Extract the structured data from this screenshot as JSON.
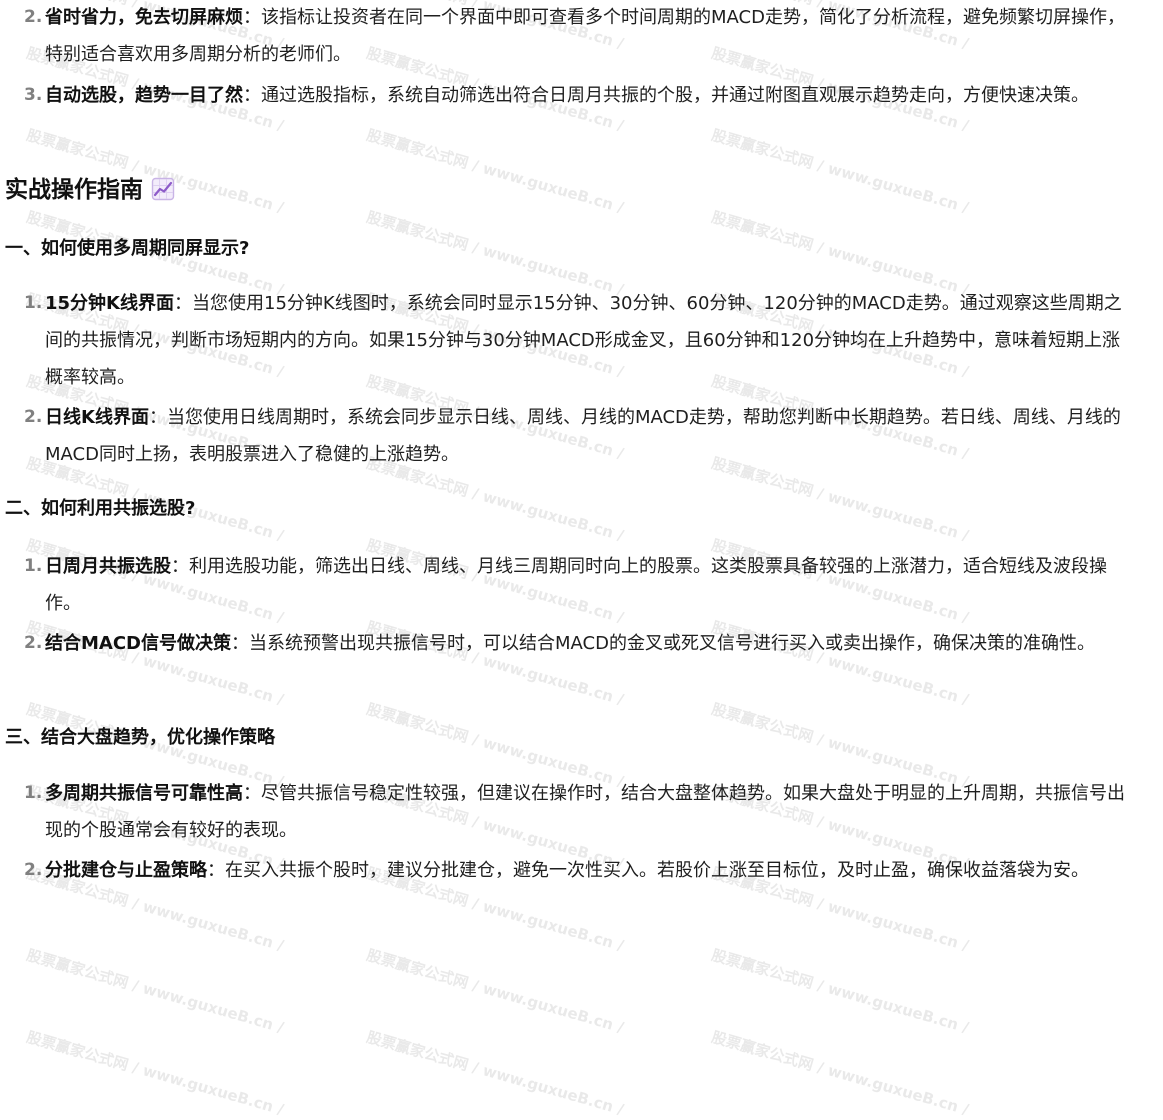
{
  "watermark": {
    "text": "股票赢家公式网 / www.guxueB.cn /"
  },
  "list_top": [
    {
      "num": "2.",
      "title": "省时省力，免去切屏麻烦",
      "sep": "：",
      "body": "该指标让投资者在同一个界面中即可查看多个时间周期的MACD走势，简化了分析流程，避免频繁切屏操作，特别适合喜欢用多周期分析的老师们。"
    },
    {
      "num": "3.",
      "title": "自动选股，趋势一目了然",
      "sep": "：",
      "body": "通过选股指标，系统自动筛选出符合日周月共振的个股，并通过附图直观展示趋势走向，方便快速决策。"
    }
  ],
  "section": {
    "title": "实战操作指南",
    "icon": "chart-increasing-icon",
    "icon_colors": {
      "frame": "#c9b4e6",
      "line": "#8e5cc9"
    }
  },
  "sub1": {
    "title": "一、如何使用多周期同屏显示?",
    "items": [
      {
        "num": "1.",
        "title": "15分钟K线界面",
        "sep": "：",
        "body": "当您使用15分钟K线图时，系统会同时显示15分钟、30分钟、60分钟、120分钟的MACD走势。通过观察这些周期之间的共振情况，判断市场短期内的方向。如果15分钟与30分钟MACD形成金叉，且60分钟和120分钟均在上升趋势中，意味着短期上涨概率较高。"
      },
      {
        "num": "2.",
        "title": "日线K线界面",
        "sep": "：",
        "body": "当您使用日线周期时，系统会同步显示日线、周线、月线的MACD走势，帮助您判断中长期趋势。若日线、周线、月线的MACD同时上扬，表明股票进入了稳健的上涨趋势。"
      }
    ]
  },
  "sub2": {
    "title": "二、如何利用共振选股?",
    "items": [
      {
        "num": "1.",
        "title": "日周月共振选股",
        "sep": "：",
        "body": "利用选股功能，筛选出日线、周线、月线三周期同时向上的股票。这类股票具备较强的上涨潜力，适合短线及波段操作。"
      },
      {
        "num": "2.",
        "title": "结合MACD信号做决策",
        "sep": "：",
        "body": "当系统预警出现共振信号时，可以结合MACD的金叉或死叉信号进行买入或卖出操作，确保决策的准确性。"
      }
    ]
  },
  "sub3": {
    "title": "三、结合大盘趋势，优化操作策略",
    "items": [
      {
        "num": "1.",
        "title": "多周期共振信号可靠性高",
        "sep": "：",
        "body": "尽管共振信号稳定性较强，但建议在操作时，结合大盘整体趋势。如果大盘处于明显的上升周期，共振信号出现的个股通常会有较好的表现。"
      },
      {
        "num": "2.",
        "title": "分批建仓与止盈策略",
        "sep": "：",
        "body": "在买入共振个股时，建议分批建仓，避免一次性买入。若股价上涨至目标位，及时止盈，确保收益落袋为安。"
      }
    ]
  }
}
